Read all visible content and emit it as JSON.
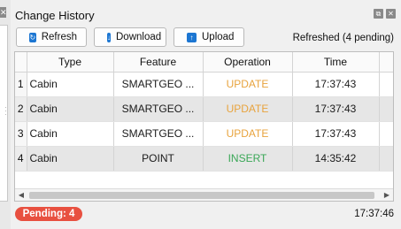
{
  "window": {
    "title": "Change History",
    "float_icon": "float-window-icon",
    "close_icon": "close-icon"
  },
  "toolbar": {
    "refresh_label": "Refresh",
    "download_label": "Download",
    "upload_label": "Upload",
    "status": "Refreshed (4 pending)"
  },
  "table": {
    "columns": [
      "Type",
      "Feature",
      "Operation",
      "Time"
    ],
    "rows": [
      {
        "n": "1",
        "type": "Cabin",
        "feature": "SMARTGEO ...",
        "operation": "UPDATE",
        "time": "17:37:43"
      },
      {
        "n": "2",
        "type": "Cabin",
        "feature": "SMARTGEO ...",
        "operation": "UPDATE",
        "time": "17:37:43"
      },
      {
        "n": "3",
        "type": "Cabin",
        "feature": "SMARTGEO ...",
        "operation": "UPDATE",
        "time": "17:37:43"
      },
      {
        "n": "4",
        "type": "Cabin",
        "feature": "POINT",
        "operation": "INSERT",
        "time": "14:35:42"
      }
    ]
  },
  "footer": {
    "pending_label": "Pending: 4",
    "clock": "17:37:46"
  },
  "colors": {
    "update": "#e8a33d",
    "insert": "#3aa757",
    "pending_badge": "#e85040",
    "button_icon": "#1c76d2"
  }
}
